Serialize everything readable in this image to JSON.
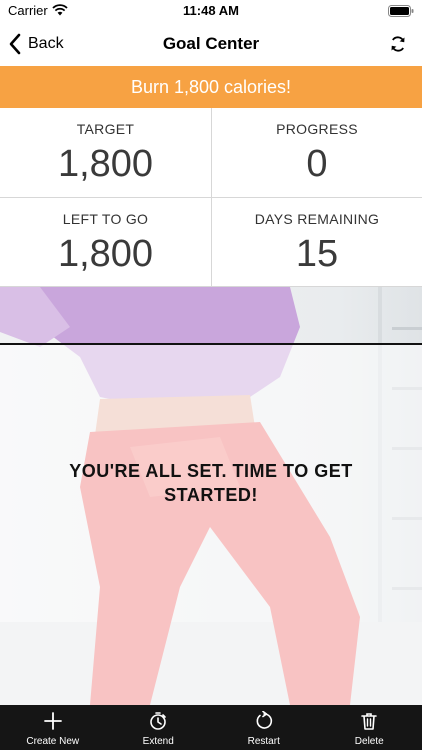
{
  "status_bar": {
    "carrier": "Carrier",
    "time": "11:48 AM"
  },
  "nav": {
    "back_label": "Back",
    "title": "Goal Center"
  },
  "banner": {
    "text": "Burn 1,800 calories!"
  },
  "stats": [
    {
      "label": "TARGET",
      "value": "1,800"
    },
    {
      "label": "PROGRESS",
      "value": "0"
    },
    {
      "label": "LEFT TO GO",
      "value": "1,800"
    },
    {
      "label": "DAYS REMAINING",
      "value": "15"
    }
  ],
  "message": "YOU'RE ALL SET. TIME TO GET STARTED!",
  "toolbar": {
    "create_new": "Create New",
    "extend": "Extend",
    "restart": "Restart",
    "delete": "Delete"
  },
  "colors": {
    "banner": "#f7a243",
    "toolbar": "#151515"
  }
}
